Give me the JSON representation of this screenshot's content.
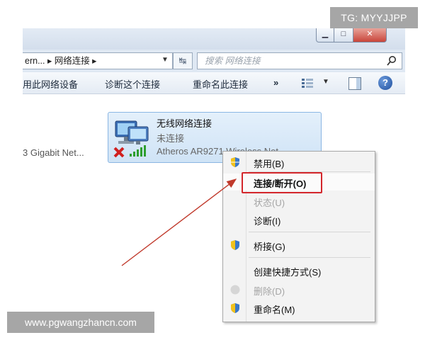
{
  "window": {
    "close_label": "✕",
    "address_path": "ern... ▸ 网络连接 ▸",
    "search_placeholder": "搜索 网络连接"
  },
  "toolbar": {
    "items": [
      "用此网络设备",
      "诊断这个连接",
      "重命名此连接"
    ],
    "more_label": "»"
  },
  "connections": {
    "gigabit_label": "3 Gigabit Net...",
    "wireless": {
      "name": "无线网络连接",
      "status": "未连接",
      "adapter": "Atheros AR9271 Wireless Net..."
    }
  },
  "context_menu": {
    "items": [
      {
        "label": "禁用(B)",
        "state": "normal",
        "icon": "shield-icon"
      },
      {
        "label": "连接/断开(O)",
        "state": "default",
        "icon": ""
      },
      {
        "label": "状态(U)",
        "state": "disabled",
        "icon": ""
      },
      {
        "label": "诊断(I)",
        "state": "normal",
        "icon": ""
      },
      {
        "label": "桥接(G)",
        "state": "normal",
        "icon": "shield-icon"
      },
      {
        "label": "创建快捷方式(S)",
        "state": "normal",
        "icon": ""
      },
      {
        "label": "删除(D)",
        "state": "disabled",
        "icon": "shield-icon"
      },
      {
        "label": "重命名(M)",
        "state": "normal",
        "icon": "shield-icon"
      }
    ]
  },
  "watermarks": {
    "tg": "TG: MYYJJPP",
    "site": "www.pgwangzhancn.com"
  },
  "colors": {
    "highlight": "#d3262b",
    "arrow": "#c0392b"
  }
}
